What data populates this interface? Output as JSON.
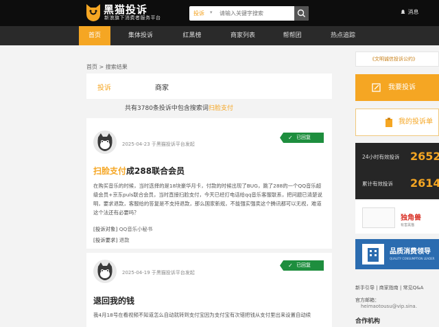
{
  "header": {
    "brand": "黑猫投诉",
    "slogan": "新浪旗下消费者服务平台",
    "search_type": "投诉",
    "search_placeholder": "请输入关键字搜索",
    "message_label": "消息"
  },
  "nav": {
    "items": [
      "首页",
      "集体投诉",
      "红黑榜",
      "商家列表",
      "帮帮团",
      "热点追踪"
    ]
  },
  "breadcrumb": {
    "home": "首页",
    "sep": ">",
    "current": "搜索结果"
  },
  "filter": {
    "tab_complaint": "投诉",
    "tab_merchant": "商家"
  },
  "summary": {
    "prefix": "共有3780条投诉中包含搜索词",
    "keyword": "扫脸支付"
  },
  "complaints": [
    {
      "date": "2025-04-23",
      "source": "于黑猫投诉平台发起",
      "status": "已回复",
      "title_highlight": "扫脸支付",
      "title_rest": "成288联合会员",
      "body": "在购买音乐的时候，当时选择的是18块豪华月卡，付款的时候出现了BUG，跳了288的一个QQ音乐超级会员+京东puls联合会员，当时直接扫脸支付，今天已经打电话给qq音乐客服联系，把问题已清楚说明，要求退款，客服给的答复是不支持退款，那么国家新规，不能强实强卖这个腾讯都可以无视，难道这个法还有必要吗？",
      "target_label": "[投诉对象]",
      "target_value": "QQ音乐小秘书",
      "request_label": "[投诉要求]",
      "request_value": "退款"
    },
    {
      "date": "2025-04-19",
      "source": "于黑猫投诉平台发起",
      "status": "已回复",
      "title": "退回我的钱",
      "body": "我4月18号在看视频不知道怎么自动就转到支付宝因为支付宝有次错把钱从支付里出来设置自动续"
    }
  ],
  "sidebar": {
    "notice": "《文明诚信投诉公约》",
    "primary_button": "我要投诉",
    "secondary_button": "我的投诉单",
    "stats": [
      {
        "label": "24小时有效投诉",
        "value": "2652"
      },
      {
        "label": "累计有效投诉",
        "value": "2614"
      }
    ],
    "ad1_text": "独角兽",
    "ad1_sub": "有害黑猫",
    "ad2_text": "品质消费领导",
    "ad2_sub": "QUALITY CONSUMPTION LEADER",
    "links": "新手引导 | 商家指南 | 常见Q&A",
    "official_label": "官方邮箱：",
    "official_mail": "heimaotousu@vip.sina.",
    "coop_title": "合作机构"
  },
  "colors": {
    "accent": "#f5a623",
    "dark": "#0d0d0d",
    "nav": "#2a2a2a",
    "success": "#1e8e3e"
  }
}
